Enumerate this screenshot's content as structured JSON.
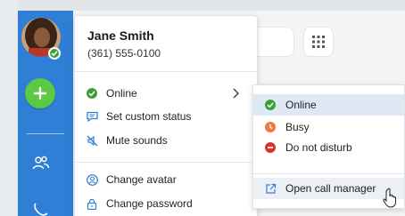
{
  "user": {
    "name": "Jane Smith",
    "phone": "(361) 555-0100",
    "presence": "online"
  },
  "menu": {
    "items": [
      {
        "label": "Online",
        "icon": "green-check-circle-icon"
      },
      {
        "label": "Set custom status",
        "icon": "chat-bubble-icon"
      },
      {
        "label": "Mute sounds",
        "icon": "muted-speaker-icon"
      },
      {
        "label": "Change avatar",
        "icon": "user-circle-icon"
      },
      {
        "label": "Change password",
        "icon": "lock-icon"
      }
    ]
  },
  "status_submenu": {
    "items": [
      {
        "label": "Online",
        "icon": "green-check-circle-icon",
        "color": "#3aa13a",
        "selected": true
      },
      {
        "label": "Busy",
        "icon": "busy-clock-icon",
        "color": "#f07b3f"
      },
      {
        "label": "Do not disturb",
        "icon": "minus-circle-icon",
        "color": "#d9342b"
      }
    ],
    "call_manager": {
      "label": "Open call manager",
      "icon": "external-link-icon"
    }
  },
  "rail": {
    "icons": [
      "avatar",
      "plus-icon",
      "contacts-icon",
      "phone-icon"
    ]
  },
  "colors": {
    "rail": "#2f7fd6",
    "new_button": "#5cc944",
    "online": "#3aa13a",
    "busy": "#f07b3f",
    "dnd": "#d9342b",
    "menu_icon": "#2f7fd6",
    "highlight": "#dfe9f5"
  }
}
